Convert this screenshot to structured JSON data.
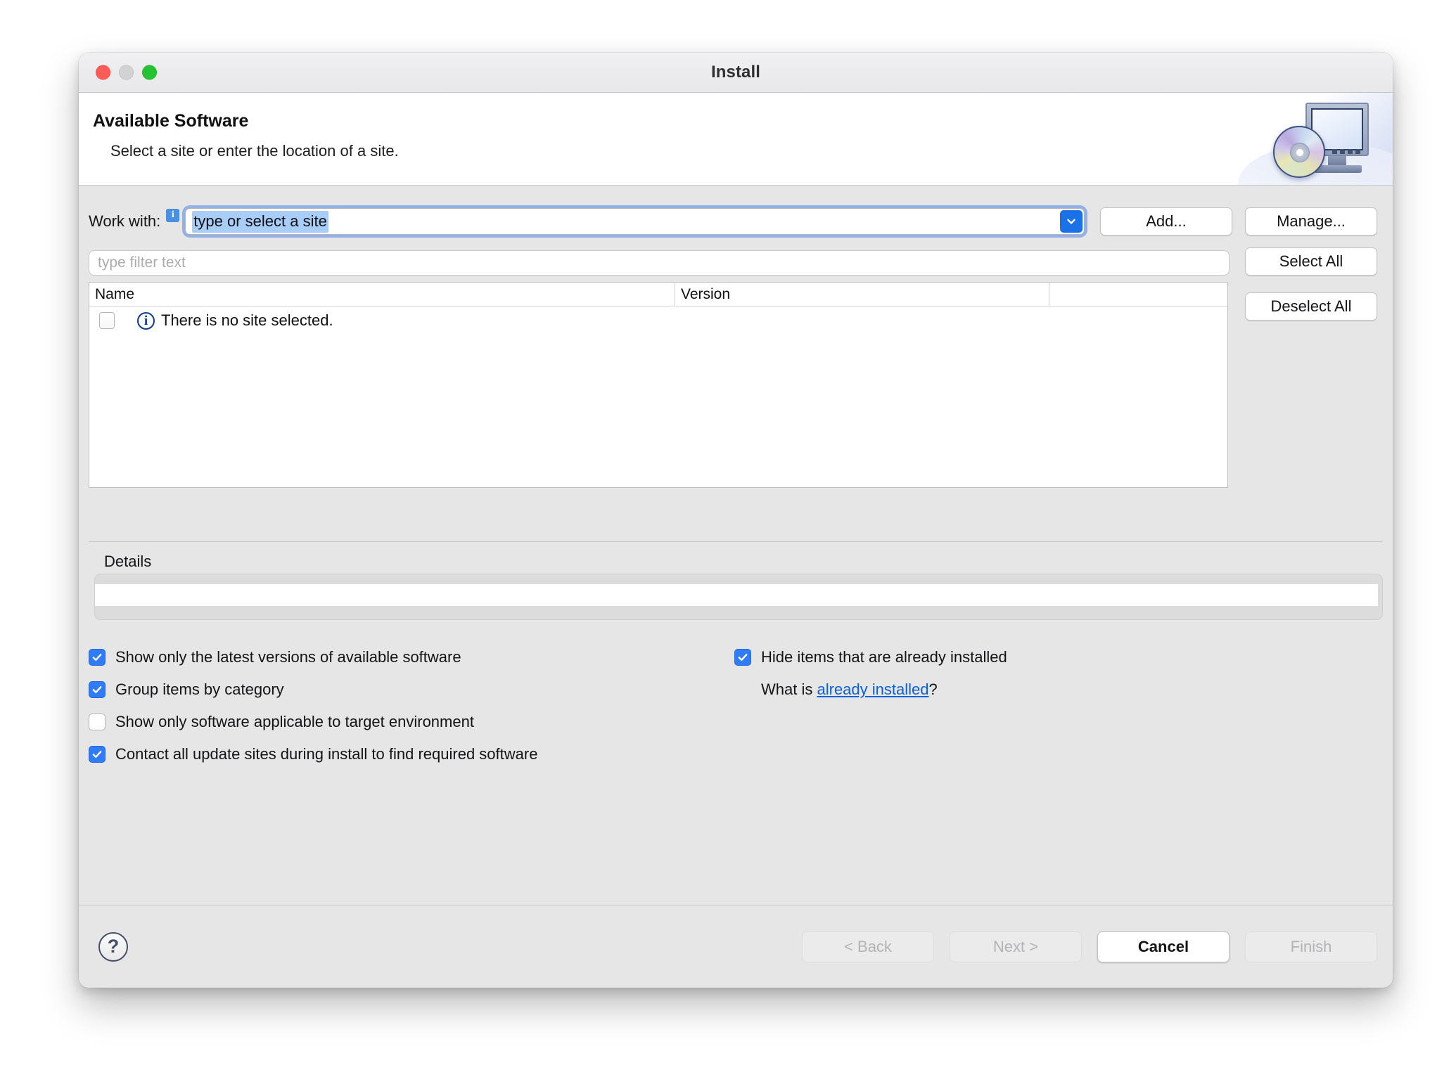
{
  "window": {
    "title": "Install",
    "controls": {
      "close": "close-button",
      "minimize": "minimize-button",
      "zoom": "zoom-button"
    }
  },
  "banner": {
    "title": "Available Software",
    "subtitle": "Select a site or enter the location of a site.",
    "artwork": "monitor-with-cd-icon"
  },
  "work_with": {
    "label": "Work with:",
    "info_badge": "i",
    "value": "type or select a site",
    "value_selected": true,
    "dropdown_icon": "chevron-down-icon"
  },
  "buttons": {
    "add": "Add...",
    "manage": "Manage...",
    "select_all": "Select All",
    "deselect_all": "Deselect All"
  },
  "filter": {
    "placeholder": "type filter text",
    "value": ""
  },
  "table": {
    "columns": [
      "Name",
      "Version"
    ],
    "rows": [
      {
        "checked": false,
        "icon": "info-circle-icon",
        "name": "There is no site selected.",
        "version": ""
      }
    ]
  },
  "details": {
    "label": "Details",
    "value": ""
  },
  "options_left": [
    {
      "label": "Show only the latest versions of available software",
      "checked": true
    },
    {
      "label": "Group items by category",
      "checked": true
    },
    {
      "label": "Show only software applicable to target environment",
      "checked": false
    },
    {
      "label": "Contact all update sites during install to find required software",
      "checked": true
    }
  ],
  "options_right": [
    {
      "label": "Hide items that are already installed",
      "checked": true
    }
  ],
  "whatis": {
    "prefix": "What is ",
    "link": "already installed",
    "suffix": "?"
  },
  "footer": {
    "help_icon": "?",
    "back": "< Back",
    "next": "Next >",
    "cancel": "Cancel",
    "finish": "Finish",
    "back_enabled": false,
    "next_enabled": false,
    "cancel_enabled": true,
    "finish_enabled": false
  },
  "colors": {
    "accent": "#2f7cf6",
    "link": "#0b61d6",
    "window_bg": "#e6e6e6",
    "titlebar_bg": "#ececee",
    "selection": "#a8cdf7",
    "info_badge": "#4a90e2"
  }
}
